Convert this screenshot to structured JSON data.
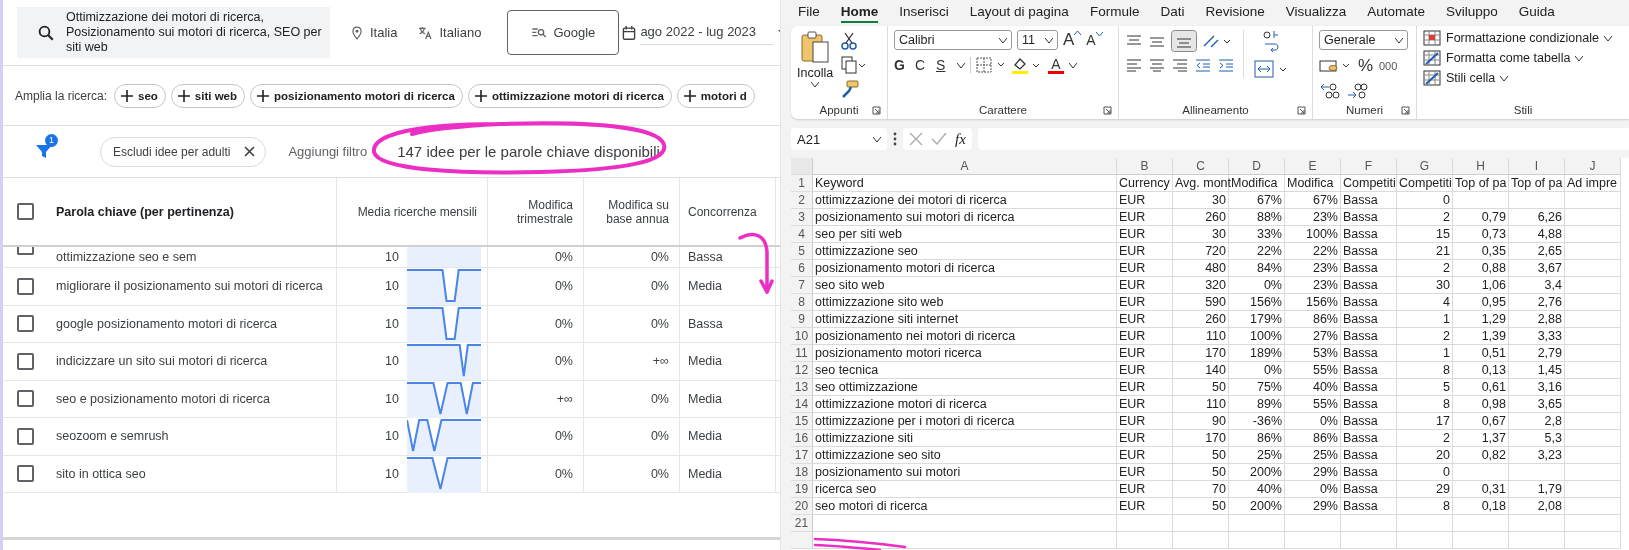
{
  "keyword_planner": {
    "search": {
      "value": "Ottimizzazione dei motori di ricerca, Posizionamento sui motori di ricerca, SEO per siti web"
    },
    "location": "Italia",
    "language": "Italiano",
    "network": "Google",
    "date_range": "ago 2022 - lug 2023",
    "broaden": {
      "label": "Amplia la ricerca:",
      "chips": [
        "seo",
        "siti web",
        "posizionamento motori di ricerca",
        "ottimizzazione motori di ricerca",
        "motori d"
      ]
    },
    "filter_badge": "1",
    "filter_chip": "Escludi idee per adulti",
    "add_filter": "Aggiungi filtro",
    "result_count": "147 idee per le parole chiave disponibili",
    "table": {
      "header_checked": false,
      "columns": [
        "Parola chiave (per pertinenza)",
        "Media ricerche mensili",
        "Modifica trimestrale",
        "Modifica su base annua",
        "Concorrenza"
      ],
      "rows": [
        {
          "checked": false,
          "keyword": "ottimizzazione seo e sem",
          "searches": "10",
          "kind": "flat",
          "quarterly": "0%",
          "yearly": "0%",
          "competition": "Bassa"
        },
        {
          "checked": false,
          "keyword": "migliorare il posizionamento sui motori di ricerca",
          "searches": "10",
          "kind": "dipmid",
          "quarterly": "0%",
          "yearly": "0%",
          "competition": "Media"
        },
        {
          "checked": false,
          "keyword": "google posizionamento motori di ricerca",
          "searches": "10",
          "kind": "dipmid",
          "quarterly": "0%",
          "yearly": "0%",
          "competition": "Bassa"
        },
        {
          "checked": false,
          "keyword": "indicizzare un sito sui motori di ricerca",
          "searches": "10",
          "kind": "diplate",
          "quarterly": "0%",
          "yearly": "+∞",
          "competition": "Media"
        },
        {
          "checked": false,
          "keyword": "seo e posizionamento motori di ricerca",
          "searches": "10",
          "kind": "doubledip",
          "quarterly": "+∞",
          "yearly": "0%",
          "competition": "Media"
        },
        {
          "checked": false,
          "keyword": "seozoom e semrush",
          "searches": "10",
          "kind": "earlydips",
          "quarterly": "0%",
          "yearly": "0%",
          "competition": "Media"
        },
        {
          "checked": false,
          "keyword": "sito in ottica seo",
          "searches": "10",
          "kind": "dipearly",
          "quarterly": "0%",
          "yearly": "0%",
          "competition": "Media"
        }
      ]
    }
  },
  "excel": {
    "menu": [
      {
        "label": "File",
        "selected": false
      },
      {
        "label": "Home",
        "selected": true
      },
      {
        "label": "Inserisci",
        "selected": false
      },
      {
        "label": "Layout di pagina",
        "selected": false
      },
      {
        "label": "Formule",
        "selected": false
      },
      {
        "label": "Dati",
        "selected": false
      },
      {
        "label": "Revisione",
        "selected": false
      },
      {
        "label": "Visualizza",
        "selected": false
      },
      {
        "label": "Automate",
        "selected": false
      },
      {
        "label": "Sviluppo",
        "selected": false
      },
      {
        "label": "Guida",
        "selected": false
      }
    ],
    "ribbon": {
      "clipboard": {
        "label": "Appunti",
        "paste": "Incolla"
      },
      "font": {
        "label": "Carattere",
        "family": "Calibri",
        "size": "11",
        "grow": "A",
        "shrink": "A",
        "bold": "G",
        "italic": "C",
        "underline": "S",
        "color_letter": "A"
      },
      "alignment": {
        "label": "Allineamento"
      },
      "number": {
        "label": "Numeri",
        "format": "Generale",
        "percent": "%",
        "thousands": "000"
      },
      "styles": {
        "label": "Stili",
        "items": [
          "Formattazione condizionale",
          "Formatta come tabella",
          "Stili cella"
        ]
      }
    },
    "name_box": "A21",
    "fx": "fx",
    "columns": [
      {
        "letter": "A",
        "kind": "text"
      },
      {
        "letter": "B",
        "kind": "text"
      },
      {
        "letter": "C",
        "kind": "number"
      },
      {
        "letter": "D",
        "kind": "number"
      },
      {
        "letter": "E",
        "kind": "number"
      },
      {
        "letter": "F",
        "kind": "text"
      },
      {
        "letter": "G",
        "kind": "number"
      },
      {
        "letter": "H",
        "kind": "number"
      },
      {
        "letter": "I",
        "kind": "number"
      },
      {
        "letter": "J",
        "kind": "text"
      }
    ],
    "rows": [
      {
        "n": "1",
        "kind": "header",
        "cells": [
          "Keyword",
          "Currency",
          "Avg. mont",
          "Modifica",
          "Modifica",
          "Competiti",
          "Competiti",
          "Top of pa",
          "Top of pa",
          "Ad impre"
        ]
      },
      {
        "n": "2",
        "kind": "data",
        "cells": [
          "ottimizzazione dei motori di ricerca",
          "EUR",
          "30",
          "67%",
          "67%",
          "Bassa",
          "0",
          null,
          null,
          null
        ]
      },
      {
        "n": "3",
        "kind": "data",
        "cells": [
          "posizionamento sui motori di ricerca",
          "EUR",
          "260",
          "88%",
          "23%",
          "Bassa",
          "2",
          "0,79",
          "6,26",
          null
        ]
      },
      {
        "n": "4",
        "kind": "data",
        "cells": [
          "seo per siti web",
          "EUR",
          "30",
          "33%",
          "100%",
          "Bassa",
          "15",
          "0,73",
          "4,88",
          null
        ]
      },
      {
        "n": "5",
        "kind": "data",
        "cells": [
          "ottimizzazione seo",
          "EUR",
          "720",
          "22%",
          "22%",
          "Bassa",
          "21",
          "0,35",
          "2,65",
          null
        ]
      },
      {
        "n": "6",
        "kind": "data",
        "cells": [
          "posizionamento motori di ricerca",
          "EUR",
          "480",
          "84%",
          "23%",
          "Bassa",
          "2",
          "0,88",
          "3,67",
          null
        ]
      },
      {
        "n": "7",
        "kind": "data",
        "cells": [
          "seo sito web",
          "EUR",
          "320",
          "0%",
          "23%",
          "Bassa",
          "30",
          "1,06",
          "3,4",
          null
        ]
      },
      {
        "n": "8",
        "kind": "data",
        "cells": [
          "ottimizzazione sito web",
          "EUR",
          "590",
          "156%",
          "156%",
          "Bassa",
          "4",
          "0,95",
          "2,76",
          null
        ]
      },
      {
        "n": "9",
        "kind": "data",
        "cells": [
          "ottimizzazione siti internet",
          "EUR",
          "260",
          "179%",
          "86%",
          "Bassa",
          "1",
          "1,29",
          "2,88",
          null
        ]
      },
      {
        "n": "10",
        "kind": "data",
        "cells": [
          "posizionamento nei motori di ricerca",
          "EUR",
          "110",
          "100%",
          "27%",
          "Bassa",
          "2",
          "1,39",
          "3,33",
          null
        ]
      },
      {
        "n": "11",
        "kind": "data",
        "cells": [
          "posizionamento motori ricerca",
          "EUR",
          "170",
          "189%",
          "53%",
          "Bassa",
          "1",
          "0,51",
          "2,79",
          null
        ]
      },
      {
        "n": "12",
        "kind": "data",
        "cells": [
          "seo tecnica",
          "EUR",
          "140",
          "0%",
          "55%",
          "Bassa",
          "8",
          "0,13",
          "1,45",
          null
        ]
      },
      {
        "n": "13",
        "kind": "data",
        "cells": [
          "seo ottimizzazione",
          "EUR",
          "50",
          "75%",
          "40%",
          "Bassa",
          "5",
          "0,61",
          "3,16",
          null
        ]
      },
      {
        "n": "14",
        "kind": "data",
        "cells": [
          "ottimizzazione motori di ricerca",
          "EUR",
          "110",
          "89%",
          "55%",
          "Bassa",
          "8",
          "0,98",
          "3,65",
          null
        ]
      },
      {
        "n": "15",
        "kind": "data",
        "cells": [
          "ottimizzazione per i motori di ricerca",
          "EUR",
          "90",
          "-36%",
          "0%",
          "Bassa",
          "17",
          "0,67",
          "2,8",
          null
        ]
      },
      {
        "n": "16",
        "kind": "data",
        "cells": [
          "ottimizzazione siti",
          "EUR",
          "170",
          "86%",
          "86%",
          "Bassa",
          "2",
          "1,37",
          "5,3",
          null
        ]
      },
      {
        "n": "17",
        "kind": "data",
        "cells": [
          "ottimizzazione seo sito",
          "EUR",
          "50",
          "25%",
          "25%",
          "Bassa",
          "20",
          "0,82",
          "3,23",
          null
        ]
      },
      {
        "n": "18",
        "kind": "data",
        "cells": [
          "posizionamento sui motori",
          "EUR",
          "50",
          "200%",
          "29%",
          "Bassa",
          "0",
          null,
          null,
          null
        ]
      },
      {
        "n": "19",
        "kind": "data",
        "cells": [
          "ricerca seo",
          "EUR",
          "70",
          "40%",
          "0%",
          "Bassa",
          "29",
          "0,31",
          "1,79",
          null
        ]
      },
      {
        "n": "20",
        "kind": "data",
        "cells": [
          "seo motori di ricerca",
          "EUR",
          "50",
          "200%",
          "29%",
          "Bassa",
          "8",
          "0,18",
          "2,08",
          null
        ]
      },
      {
        "n": "21",
        "kind": "empty",
        "cells": [
          null,
          null,
          null,
          null,
          null,
          null,
          null,
          null,
          null,
          null
        ]
      }
    ]
  }
}
